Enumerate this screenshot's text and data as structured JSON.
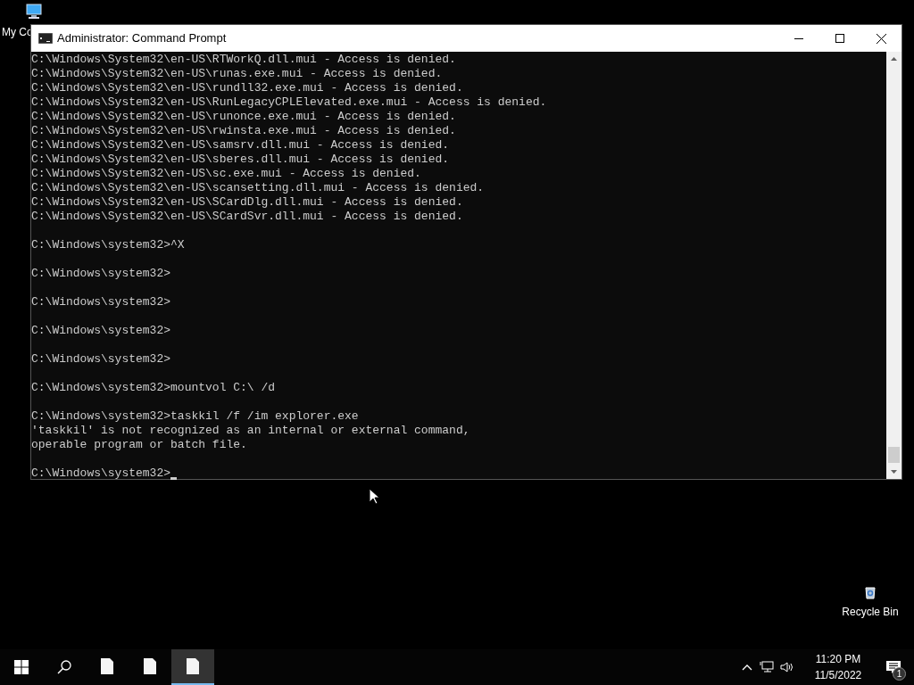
{
  "desktop_icons": [
    {
      "label": "My Co",
      "kind": "computer"
    },
    {
      "label": "Recycle Bin",
      "kind": "recycle"
    }
  ],
  "window": {
    "title": "Administrator: Command Prompt",
    "console": {
      "blocks": [
        [
          "C:\\Windows\\System32\\en-US\\RTWorkQ.dll.mui - Access is denied.",
          "C:\\Windows\\System32\\en-US\\runas.exe.mui - Access is denied.",
          "C:\\Windows\\System32\\en-US\\rundll32.exe.mui - Access is denied.",
          "C:\\Windows\\System32\\en-US\\RunLegacyCPLElevated.exe.mui - Access is denied.",
          "C:\\Windows\\System32\\en-US\\runonce.exe.mui - Access is denied.",
          "C:\\Windows\\System32\\en-US\\rwinsta.exe.mui - Access is denied.",
          "C:\\Windows\\System32\\en-US\\samsrv.dll.mui - Access is denied.",
          "C:\\Windows\\System32\\en-US\\sberes.dll.mui - Access is denied.",
          "C:\\Windows\\System32\\en-US\\sc.exe.mui - Access is denied.",
          "C:\\Windows\\System32\\en-US\\scansetting.dll.mui - Access is denied.",
          "C:\\Windows\\System32\\en-US\\SCardDlg.dll.mui - Access is denied.",
          "C:\\Windows\\System32\\en-US\\SCardSvr.dll.mui - Access is denied."
        ],
        [
          "C:\\Windows\\system32>^X"
        ],
        [
          "C:\\Windows\\system32>"
        ],
        [
          "C:\\Windows\\system32>"
        ],
        [
          "C:\\Windows\\system32>"
        ],
        [
          "C:\\Windows\\system32>"
        ],
        [
          "C:\\Windows\\system32>mountvol C:\\ /d"
        ],
        [
          "C:\\Windows\\system32>taskkil /f /im explorer.exe",
          "'taskkil' is not recognized as an internal or external command,",
          "operable program or batch file."
        ],
        [
          "C:\\Windows\\system32>"
        ]
      ],
      "cursor": true
    }
  },
  "taskbar": {
    "apps": [
      {
        "selected": false
      },
      {
        "selected": false
      },
      {
        "selected": true
      }
    ],
    "clock": {
      "time": "11:20 PM",
      "date": "11/5/2022"
    },
    "notification_count": "1"
  }
}
